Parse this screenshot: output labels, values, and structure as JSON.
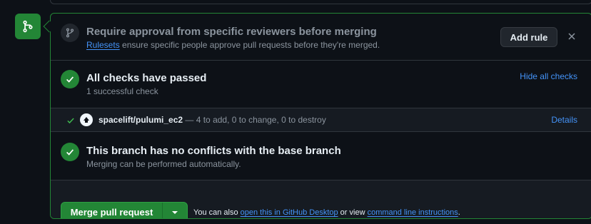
{
  "approval": {
    "title": "Require approval from specific reviewers before merging",
    "sub_link": "Rulesets",
    "sub_text": " ensure specific people approve pull requests before they're merged.",
    "add_rule_label": "Add rule"
  },
  "checks": {
    "title": "All checks have passed",
    "subtitle": "1 successful check",
    "hide_label": "Hide all checks",
    "items": [
      {
        "name": "spacelift/pulumi_ec2",
        "description": " — 4 to add, 0 to change, 0 to destroy",
        "details_label": "Details"
      }
    ]
  },
  "conflicts": {
    "title": "This branch has no conflicts with the base branch",
    "subtitle": "Merging can be performed automatically."
  },
  "merge": {
    "button_label": "Merge pull request",
    "help_prefix": "You can also ",
    "desktop_link": "open this in GitHub Desktop",
    "help_middle": " or view ",
    "cli_link": "command line instructions",
    "help_suffix": "."
  },
  "colors": {
    "success_green": "#238636",
    "link_blue": "#4493f8",
    "background": "#0d1117"
  }
}
